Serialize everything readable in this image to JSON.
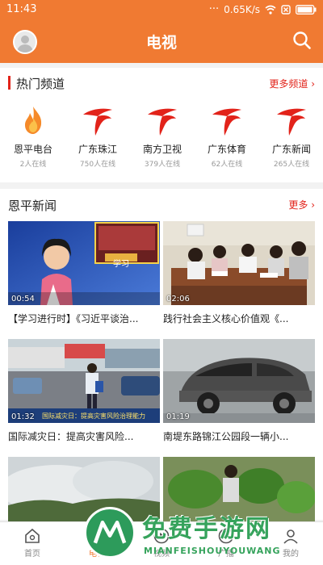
{
  "status": {
    "time": "11:43",
    "speed": "0.65K/s"
  },
  "header": {
    "title": "电视"
  },
  "hot": {
    "title": "热门频道",
    "more": "更多频道",
    "channels": [
      {
        "name": "恩平电台",
        "online": "2人在线",
        "logo": "flame"
      },
      {
        "name": "广东珠江",
        "online": "750人在线",
        "logo": "gdtv"
      },
      {
        "name": "南方卫视",
        "online": "379人在线",
        "logo": "gdtv"
      },
      {
        "name": "广东体育",
        "online": "62人在线",
        "logo": "gdtv"
      },
      {
        "name": "广东新闻",
        "online": "265人在线",
        "logo": "gdtv"
      }
    ]
  },
  "news": {
    "title": "恩平新闻",
    "more": "更多",
    "items": [
      {
        "title": "【学习进行时】《习近平谈治...",
        "duration": "00:54",
        "thumb_word": "学习"
      },
      {
        "title": "践行社会主义核心价值观《...",
        "duration": "02:06"
      },
      {
        "title": "国际减灾日：提高灾害风险...",
        "duration": "01:32",
        "caption": "国际减灾日：提高灾害风险治理能力"
      },
      {
        "title": "南堤东路锦江公园段一辆小...",
        "duration": "01:19"
      },
      {
        "title": "",
        "duration": ""
      },
      {
        "title": "",
        "duration": ""
      }
    ]
  },
  "tabs": [
    {
      "label": "首页",
      "icon": "home-icon"
    },
    {
      "label": "电视",
      "icon": "tv-icon"
    },
    {
      "label": "视频",
      "icon": "play-icon"
    },
    {
      "label": "广播",
      "icon": "radio-icon"
    },
    {
      "label": "我的",
      "icon": "user-icon"
    }
  ],
  "watermark": {
    "big": "免费手游网",
    "small": "MIANFEISHOUYOUWANG"
  },
  "colors": {
    "accent": "#f07a32",
    "red": "#e2231a",
    "watermark": "#36a35c"
  }
}
